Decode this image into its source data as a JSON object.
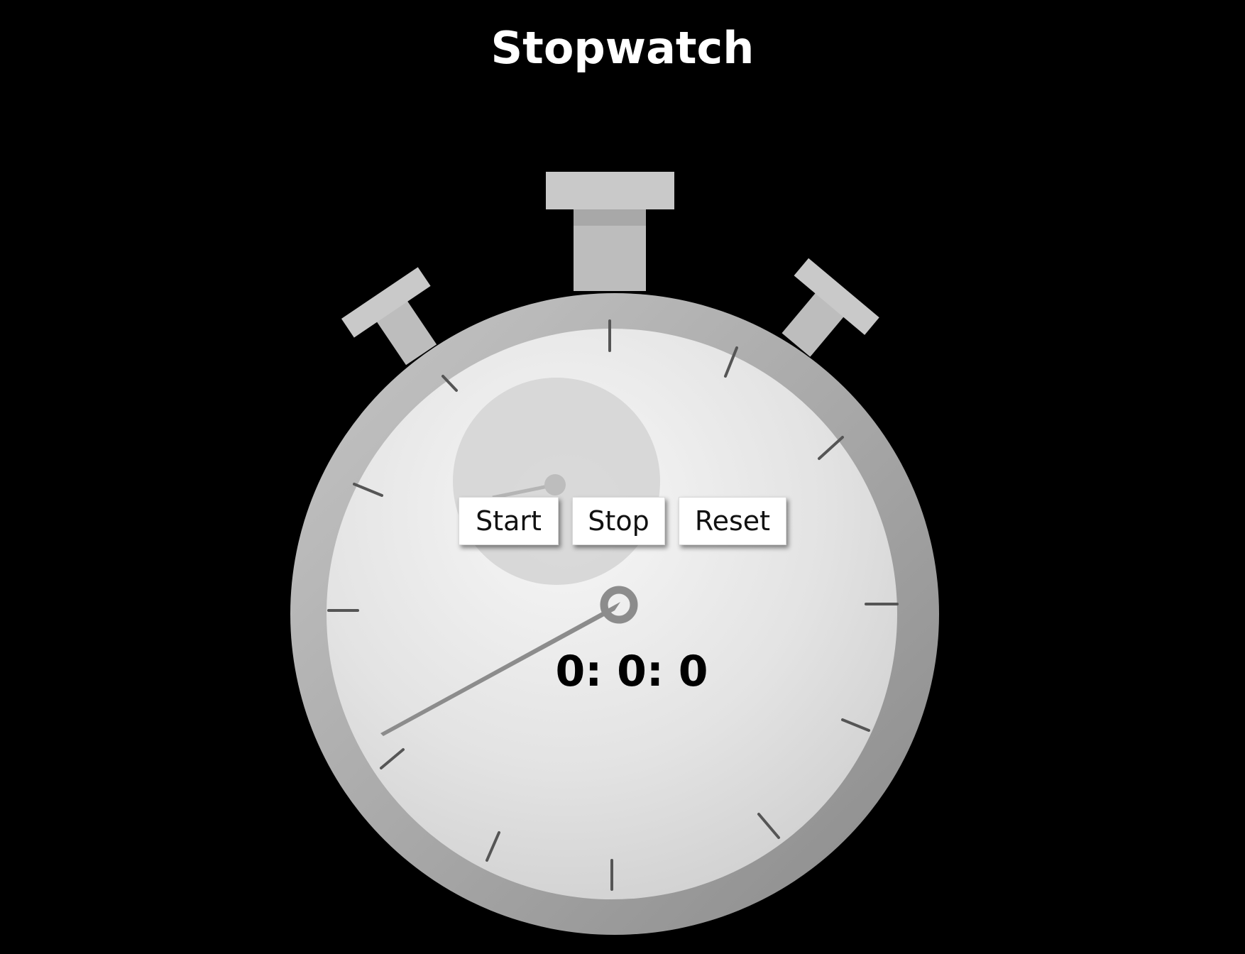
{
  "header": {
    "title": "Stopwatch"
  },
  "controls": {
    "start_label": "Start",
    "stop_label": "Stop",
    "reset_label": "Reset"
  },
  "display": {
    "time": "0: 0: 0"
  },
  "colors": {
    "background": "#000000",
    "title_text": "#ffffff",
    "watch_case": "#a8a8a8",
    "watch_face": "#e2e2e2",
    "tick_marks": "#555555",
    "hand": "#8c8c8c"
  }
}
